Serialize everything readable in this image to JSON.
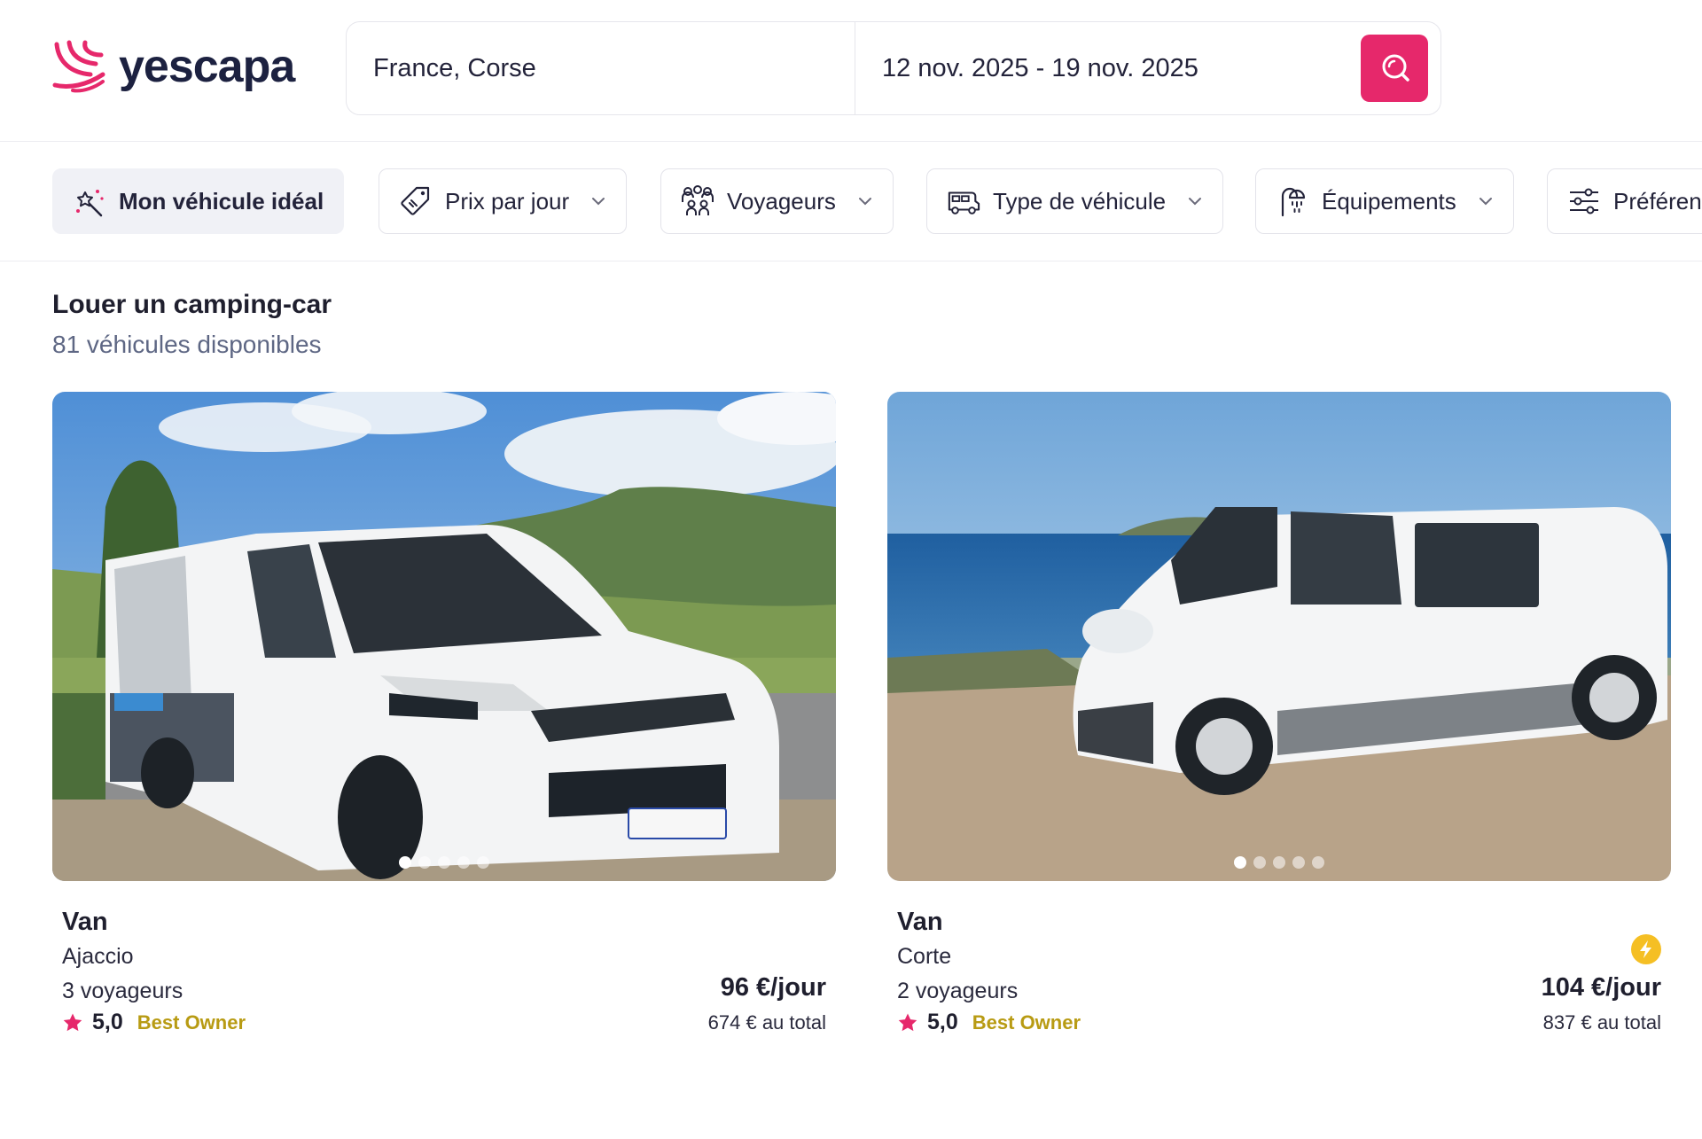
{
  "brand": {
    "name": "yescapa",
    "accent": "#e6286b"
  },
  "search": {
    "location": "France, Corse",
    "dates": "12 nov. 2025 - 19 nov. 2025",
    "button_icon": "search-icon"
  },
  "filters": [
    {
      "label": "Mon véhicule idéal",
      "icon": "magic-wand-icon",
      "dropdown": false
    },
    {
      "label": "Prix par jour",
      "icon": "price-tag-icon",
      "dropdown": true
    },
    {
      "label": "Voyageurs",
      "icon": "travelers-icon",
      "dropdown": true
    },
    {
      "label": "Type de véhicule",
      "icon": "vehicle-type-icon",
      "dropdown": true
    },
    {
      "label": "Équipements",
      "icon": "shower-icon",
      "dropdown": true
    },
    {
      "label": "Préférences",
      "icon": "sliders-icon",
      "dropdown": false
    }
  ],
  "results": {
    "title": "Louer un camping-car",
    "count": "81 véhicules disponibles"
  },
  "cards": [
    {
      "type": "Van",
      "city": "Ajaccio",
      "travelers": "3 voyageurs",
      "rating": "5,0",
      "badge": "Best Owner",
      "price": "96 €/jour",
      "total": "674 € au total",
      "instant_book": false,
      "photo_count": 5,
      "active_photo": 1
    },
    {
      "type": "Van",
      "city": "Corte",
      "travelers": "2 voyageurs",
      "rating": "5,0",
      "badge": "Best Owner",
      "price": "104 €/jour",
      "total": "837 € au total",
      "instant_book": true,
      "photo_count": 5,
      "active_photo": 1
    }
  ]
}
